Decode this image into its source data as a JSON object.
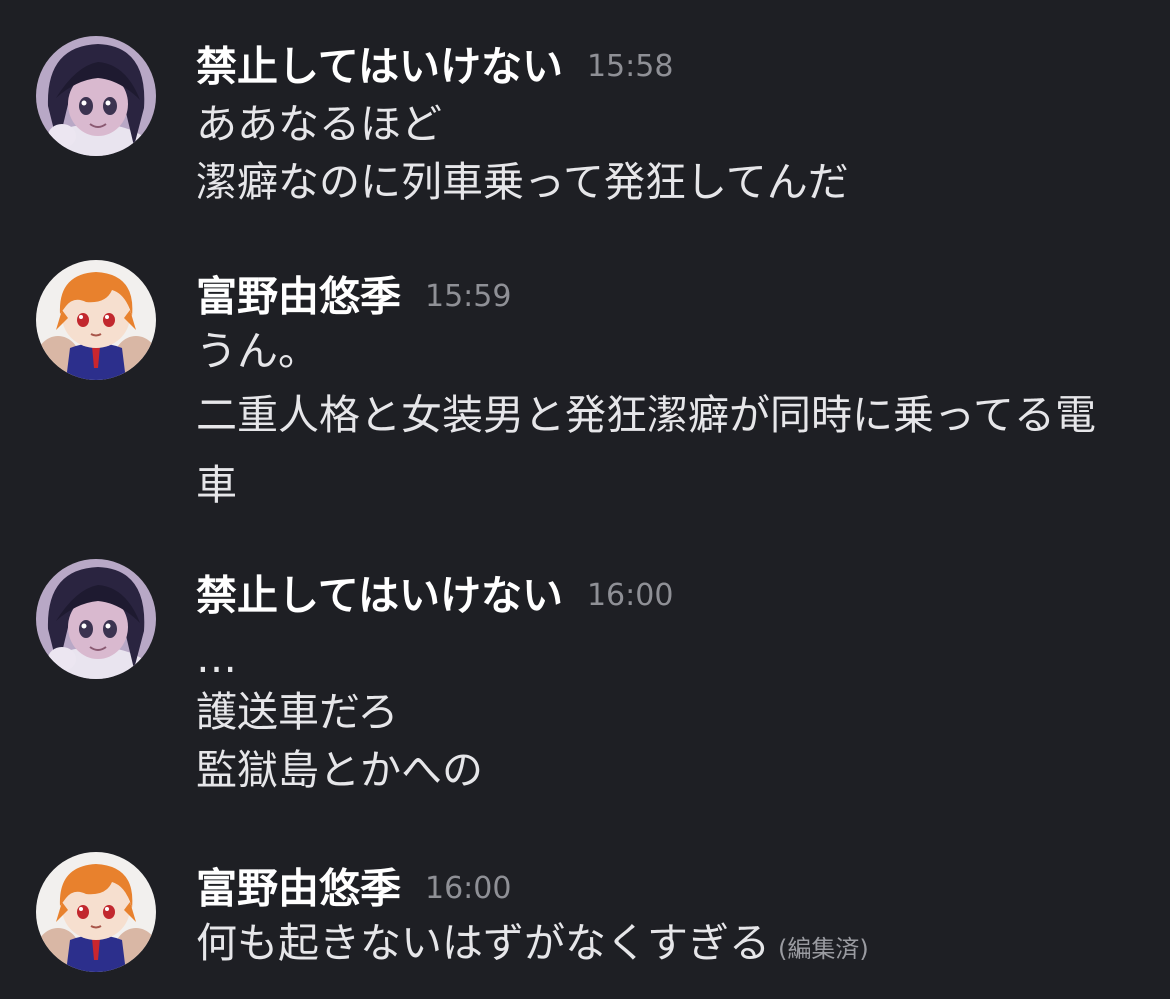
{
  "messages": [
    {
      "author": "禁止してはいけない",
      "time": "15:58",
      "avatar": "purple-hair-figure-avatar",
      "lines": [
        "ああなるほど",
        "潔癖なのに列車乗って発狂してんだ"
      ]
    },
    {
      "author": "富野由悠季",
      "time": "15:59",
      "avatar": "orange-hair-plush-avatar",
      "lines": [
        "うん。",
        "二重人格と女装男と発狂潔癖が同時に乗ってる電車"
      ]
    },
    {
      "author": "禁止してはいけない",
      "time": "16:00",
      "avatar": "purple-hair-figure-avatar",
      "lines": [
        "…",
        "護送車だろ",
        "監獄島とかへの"
      ]
    },
    {
      "author": "富野由悠季",
      "time": "16:00",
      "avatar": "orange-hair-plush-avatar",
      "lines": [
        "何も起きないはずがなくすぎる"
      ],
      "edited_label": "(編集済)"
    }
  ],
  "colors": {
    "background": "#1e1f24",
    "name": "#ffffff",
    "text": "#e6e6e9",
    "timestamp": "#8f9096"
  }
}
